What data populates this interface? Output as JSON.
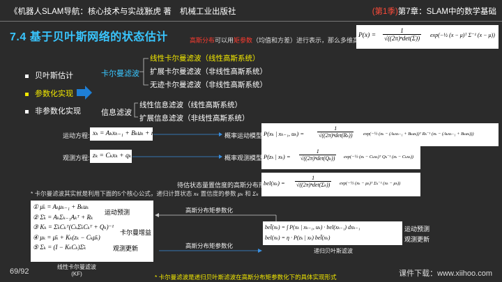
{
  "header": {
    "book_title": "《机器人SLAM导航：核心技术与实战》",
    "author": "张虎 著",
    "publisher": "机械工业出版社",
    "season": "(第1季)",
    "chapter": "第7章：SLAM中的数学基础"
  },
  "section_title": "7.4 基于贝叶斯网络的状态估计",
  "intro": {
    "highlight": "高斯分布",
    "text_a": "可以用",
    "highlight2": "矩参数",
    "text_b": "（均值和方差）进行表示，那么多维高斯分布为:"
  },
  "formulas": {
    "gaussian": "P(x) = 1/√((2π)ⁿ det(Σ)) · exp(−½ (x − μ)ᵀ Σ⁻¹ (x − μ))",
    "gaussian_num": "1",
    "gaussian_den": "√((2π)ⁿdet(Σ))",
    "gaussian_lhs": "P(x) =",
    "gaussian_exp": "exp(−½ (x − μ)ᵀ Σ⁻¹ (x − μ))",
    "motion_eq": "xₖ = Aₖxₖ₋₁ + Bₖuₖ + rₖ",
    "motion_prob_lhs": "P(xₖ | xₖ₋₁, uₖ) =",
    "motion_prob_den": "√((2π)ⁿdet(Rₖ))",
    "motion_prob_exp": "exp(−½ (xₖ − (Aₖxₖ₋₁ + Bₖuₖ))ᵀ Rₖ⁻¹ (xₖ − (Aₖxₖ₋₁ + Bₖuₖ)))",
    "obs_eq": "zₖ = Cₖxₖ + qₖ",
    "obs_prob_lhs": "P(zₖ | xₖ) =",
    "obs_prob_den": "√((2π)ⁿdet(Qₖ))",
    "obs_prob_exp": "exp(−½ (zₖ − Cₖxₖ)ᵀ Qₖ⁻¹ (zₖ − Cₖxₖ))",
    "bel_lhs": "bel(xₖ) =",
    "bel_den": "√((2π)ⁿdet(Σₖ))",
    "bel_exp": "exp(−½ (xₖ − μₖ)ᵀ Σₖ⁻¹ (xₖ − μₖ))",
    "kf_1": "① μ̄ₖ = Aₖμₖ₋₁ + Bₖuₖ",
    "kf_2": "② Σ̄ₖ = AₖΣₖ₋₁Aₖᵀ + Rₖ",
    "kf_3": "③ Kₖ = Σ̄ₖCₖᵀ(CₖΣ̄ₖCₖᵀ + Qₖ)⁻¹",
    "kf_4": "④ μₖ = μ̄ₖ + Kₖ(zₖ − Cₖμ̄ₖ)",
    "kf_5": "⑤ Σₖ = (I − KₖCₖ)Σ̄ₖ",
    "bayes_1": "bel̄(xₖ) = ∫ P(xₖ | xₖ₋₁, uₖ) · bel(xₖ₋₁) dxₖ₋₁",
    "bayes_2": "bel(xₖ) = η · P(zₖ | xₖ) bel̄(xₖ)"
  },
  "bullets": [
    {
      "label": "贝叶斯估计"
    },
    {
      "label": "参数化实现"
    },
    {
      "label": "非参数化实现"
    }
  ],
  "kalman": {
    "title": "卡尔曼滤波",
    "items": [
      "线性卡尔曼滤波（线性高斯系统）",
      "扩展卡尔曼滤波（非线性高斯系统）",
      "无迹卡尔曼滤波（非线性高斯系统）"
    ]
  },
  "info_filter": {
    "title": "信息滤波",
    "items": [
      "线性信息滤波（线性高斯系统）",
      "扩展信息滤波（非线性高斯系统）"
    ]
  },
  "labels": {
    "motion_eq": "运动方程:",
    "motion_model": "概率运动模型:",
    "obs_eq": "观测方程:",
    "obs_model": "概率观测模型:",
    "bel_desc": "待估状态量置信度的高斯分布形式:",
    "kf_predict": "运动预测",
    "kf_gain": "卡尔曼增益",
    "kf_update": "观测更新",
    "bayes_predict": "运动预测",
    "bayes_update": "观测更新",
    "flow_top": "高斯分布矩参数化",
    "flow_bottom": "高斯分布矩参数化",
    "kf_caption_1": "线性卡尔曼滤波",
    "kf_caption_2": "(KF)",
    "bayes_caption": "递归贝叶斯滤波"
  },
  "note": {
    "a": "* 卡尔曼滤波其实就是利用下面的5个核心公式，递归计算状态",
    "x": "xₖ",
    "b": "置信度的参数",
    "mu": "μₖ",
    "and": "和",
    "sigma": "Σₖ"
  },
  "footer": {
    "page": "69/92",
    "download": "课件下载：www.xiihoo.com",
    "footnote": "* 卡尔曼滤波是递归贝叶斯滤波在高斯分布矩参数化下的具体实现形式"
  },
  "colors": {
    "background": "#2b2b2b",
    "accent_blue": "#39c6ff",
    "accent_yellow": "#f2e800",
    "accent_red": "#ff3b2f",
    "arrow_blue": "#1e7fd6"
  }
}
